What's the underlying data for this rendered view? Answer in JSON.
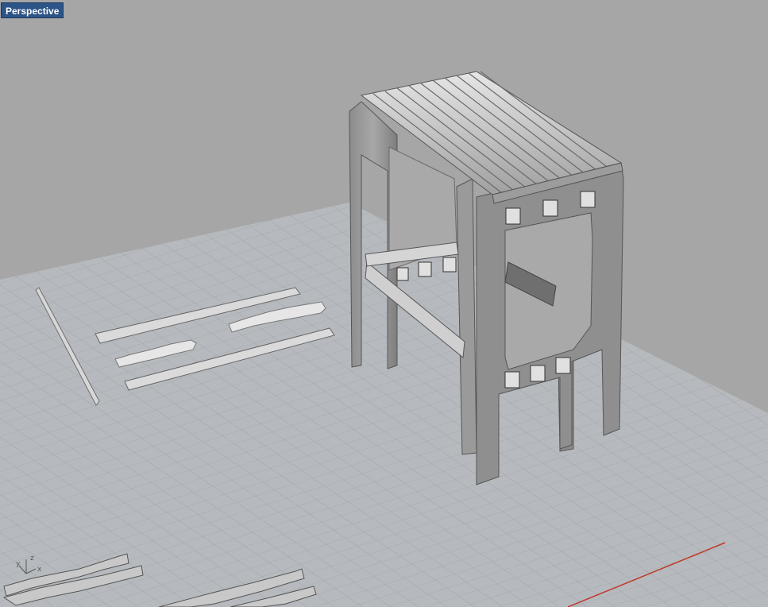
{
  "viewport": {
    "title": "Perspective",
    "axis_labels": {
      "x": "x",
      "y": "y",
      "z": "z"
    }
  },
  "colors": {
    "background": "#a6a6a6",
    "grid_surface": "#b5b9bd",
    "grid_line": "#9da1a5",
    "grid_major": "#8d9194",
    "x_axis": "#c0392b",
    "part_face": "#d2d2d2",
    "part_side": "#8f8f8f",
    "tab_bg": "#2d5487"
  }
}
